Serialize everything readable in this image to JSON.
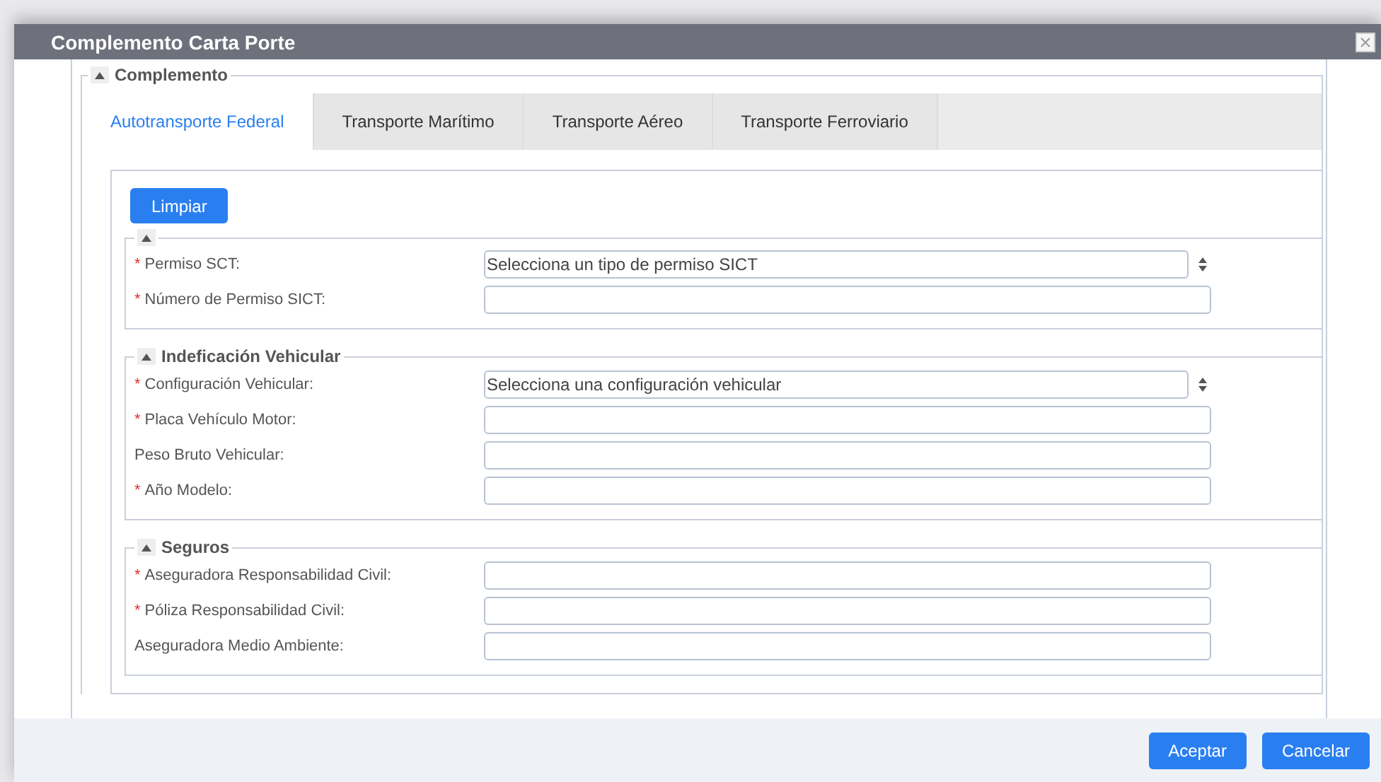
{
  "window": {
    "title": "Complemento Carta Porte"
  },
  "complemento": {
    "legend": "Complemento",
    "expanded": true
  },
  "tabs": [
    {
      "label": "Autotransporte Federal",
      "selected": true
    },
    {
      "label": "Transporte Marítimo",
      "selected": false
    },
    {
      "label": "Transporte Aéreo",
      "selected": false
    },
    {
      "label": "Transporte Ferroviario",
      "selected": false
    }
  ],
  "clear_button": "Limpiar",
  "required_mark": "*",
  "sections": [
    {
      "expanded": true,
      "fields": [
        {
          "label": "Permiso SCT:",
          "required": true,
          "kind": "select",
          "value": "Selecciona un tipo de permiso SICT"
        },
        {
          "label": "Número de Permiso SICT:",
          "required": true,
          "kind": "text"
        }
      ]
    },
    {
      "title": "Indeficación Vehicular",
      "expanded": true,
      "fields": [
        {
          "label": "Configuración Vehicular:",
          "required": true,
          "kind": "select",
          "value": "Selecciona una configuración vehicular"
        },
        {
          "label": "Placa Vehículo Motor:",
          "required": true,
          "kind": "text"
        },
        {
          "label": "Peso Bruto Vehicular:",
          "required": false,
          "kind": "text"
        },
        {
          "label": "Año Modelo:",
          "required": true,
          "kind": "text"
        }
      ]
    },
    {
      "title": "Seguros",
      "expanded": true,
      "fields": [
        {
          "label": "Aseguradora Responsabilidad Civil:",
          "required": true,
          "kind": "text"
        },
        {
          "label": "Póliza Responsabilidad Civil:",
          "required": true,
          "kind": "text"
        },
        {
          "label": "Aseguradora Medio Ambiente:",
          "required": false,
          "kind": "text"
        }
      ]
    }
  ],
  "footer_buttons": [
    "Aceptar",
    "Cancelar"
  ]
}
